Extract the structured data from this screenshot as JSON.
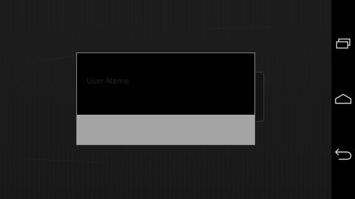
{
  "login_dialog": {
    "username_placeholder": "User Name",
    "username_value": ""
  },
  "navigation_bar": {
    "buttons": [
      {
        "name": "recent-apps",
        "icon": "recent-apps-icon"
      },
      {
        "name": "home",
        "icon": "home-icon"
      },
      {
        "name": "back",
        "icon": "back-icon"
      }
    ]
  },
  "colors": {
    "background": "#1e1e1e",
    "dialog_body": "#000000",
    "dialog_border": "#8a8a8a",
    "dialog_button_bar": "#a4a4a4",
    "navbar": "#000000",
    "nav_icon": "#d8d8d8"
  }
}
